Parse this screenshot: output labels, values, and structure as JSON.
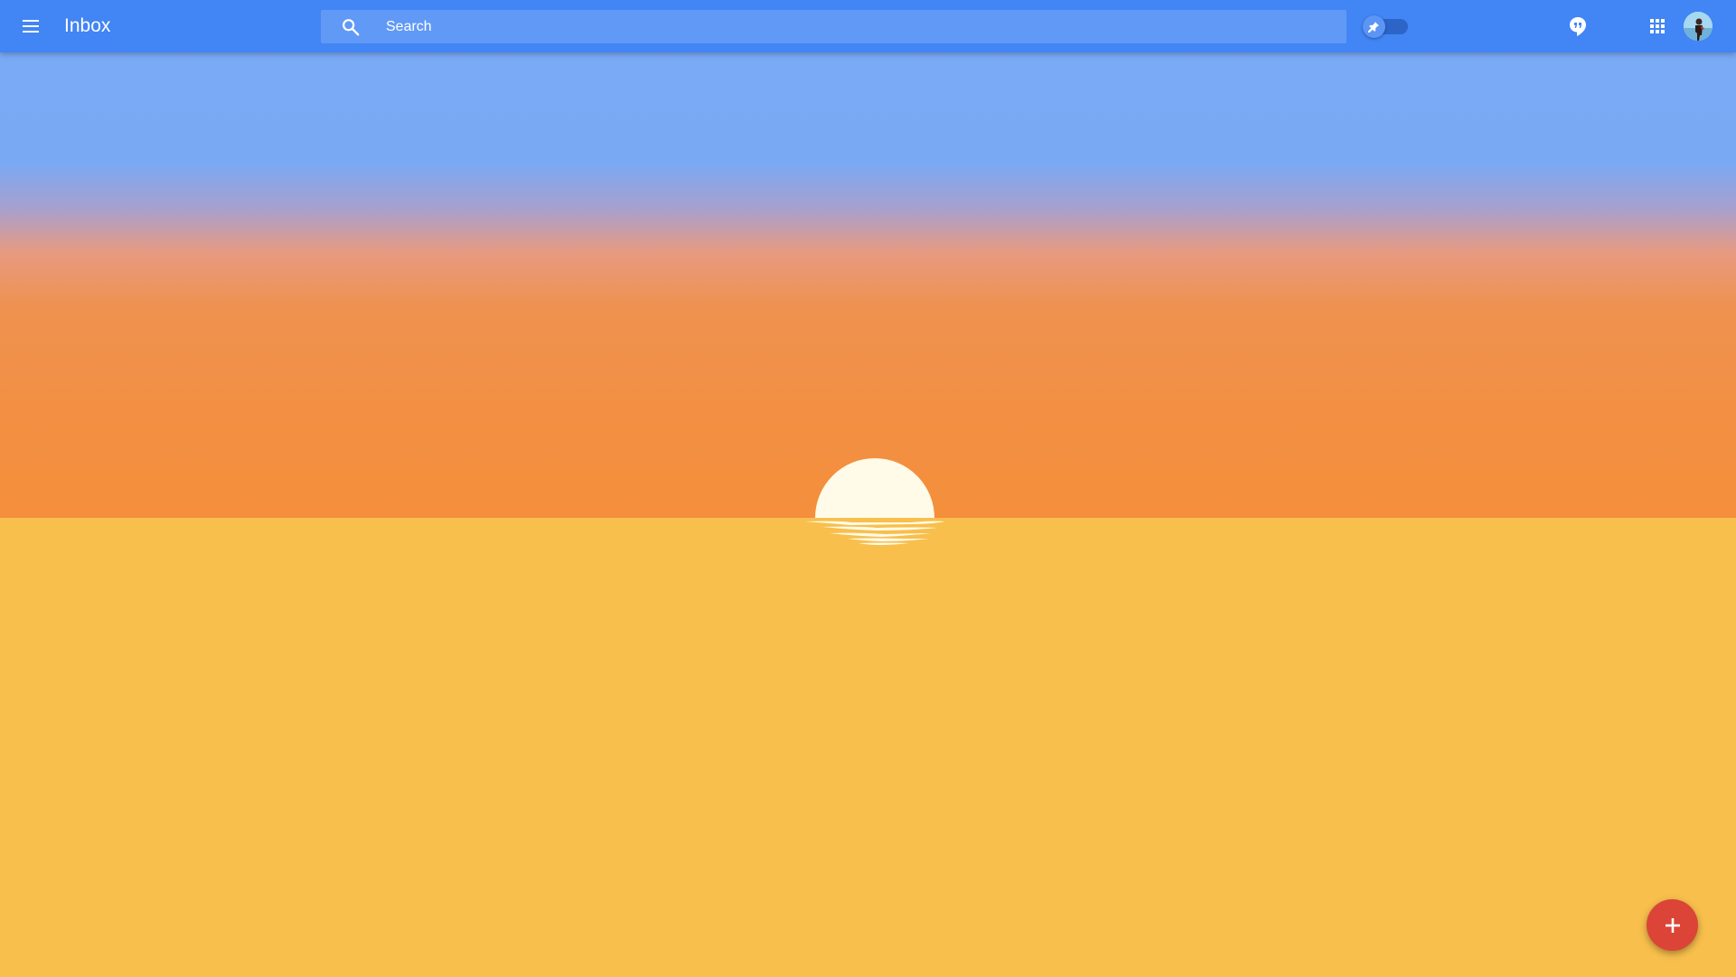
{
  "header": {
    "title": "Inbox",
    "menu_icon": "hamburger-menu-icon",
    "search": {
      "placeholder": "Search",
      "value": "",
      "icon": "search-icon"
    },
    "pin_toggle": {
      "icon": "pin-icon",
      "state": "off"
    },
    "hangouts_icon": "hangouts-icon",
    "apps_icon": "apps-grid-icon",
    "avatar_icon": "account-avatar"
  },
  "main": {
    "empty_state_illustration": "sunset-over-sea",
    "colors": {
      "header": "#4285f4",
      "sky_top": "#7aaaf6",
      "sky_bottom": "#f58f3c",
      "sea": "#f8bf4c",
      "sun": "#fffbe8"
    }
  },
  "fab": {
    "icon": "plus-icon",
    "color": "#db4437"
  }
}
